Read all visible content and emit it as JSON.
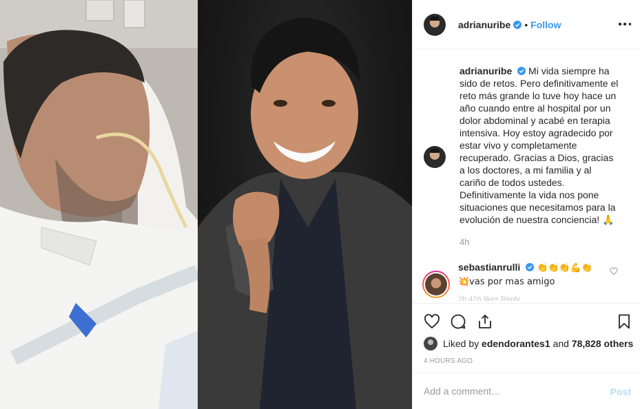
{
  "header": {
    "username": "adrianuribe",
    "separator": "•",
    "follow_label": "Follow"
  },
  "caption": {
    "username": "adrianuribe",
    "text": "Mi vida siempre ha sido de retos. Pero definitivamente el reto más grande lo tuve hoy hace un año cuando entre al hospital por un dolor abdominal y acabé en terapia intensiva. Hoy estoy agradecido por estar vivo y completamente recuperado. Gracias a Dios, gracias a los doctores, a mi familia y al cariño de todos ustedes. Definitivamente la vida nos pone situaciones que necesitamos para la evolución de nuestra conciencia! 🙏",
    "time": "4h"
  },
  "comment": {
    "username": "sebastianrulli",
    "emojis": "👏👏👏💪👏",
    "text": "💥vas por mas amigo",
    "faded_meta": "2h   426 likes   Reply"
  },
  "likes": {
    "prefix": "Liked by",
    "user": "edendorantes1",
    "connector": "and",
    "others": "78,828 others"
  },
  "timestamp": "4 HOURS AGO",
  "add_comment": {
    "placeholder": "Add a comment…",
    "post_label": "Post"
  },
  "icons": {
    "like": "heart-icon",
    "comment": "comment-icon",
    "share": "share-icon",
    "save": "bookmark-icon",
    "more": "more-options-icon",
    "verified": "verified-badge-icon"
  },
  "colors": {
    "link_blue": "#3897f0",
    "post_disabled": "#b2dffc",
    "meta_gray": "#999999",
    "border": "#efefef",
    "verified": "#3897f0"
  }
}
